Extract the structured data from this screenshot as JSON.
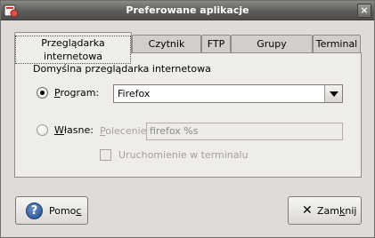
{
  "window": {
    "title": "Preferowane aplikacje"
  },
  "tabs": [
    {
      "label": "Przeglądarka internetowa"
    },
    {
      "label": "Czytnik poczty"
    },
    {
      "label": "FTP"
    },
    {
      "label": "Grupy dyskusyjne"
    },
    {
      "label": "Terminal"
    }
  ],
  "browser": {
    "section_label": "Domyślna przeglądarka internetowa",
    "program_option": {
      "label_mnemonic": "P",
      "label_rest": "rogram:",
      "checked": true
    },
    "program_selected": "Firefox",
    "custom_option": {
      "label_mnemonic": "W",
      "label_rest": "łasne:",
      "checked": false
    },
    "command_label_mnemonic": "P",
    "command_label_rest": "olecenie:",
    "command_value": "firefox %s",
    "terminal_label": "Uruchomienie w terminalu"
  },
  "buttons": {
    "help_pre": "Pomo",
    "help_mnemonic": "c",
    "close_pre": "Zam",
    "close_mnemonic": "k",
    "close_post": "nij"
  },
  "icons": {
    "app": "app-icon",
    "help": "help-icon",
    "close": "close-icon"
  }
}
